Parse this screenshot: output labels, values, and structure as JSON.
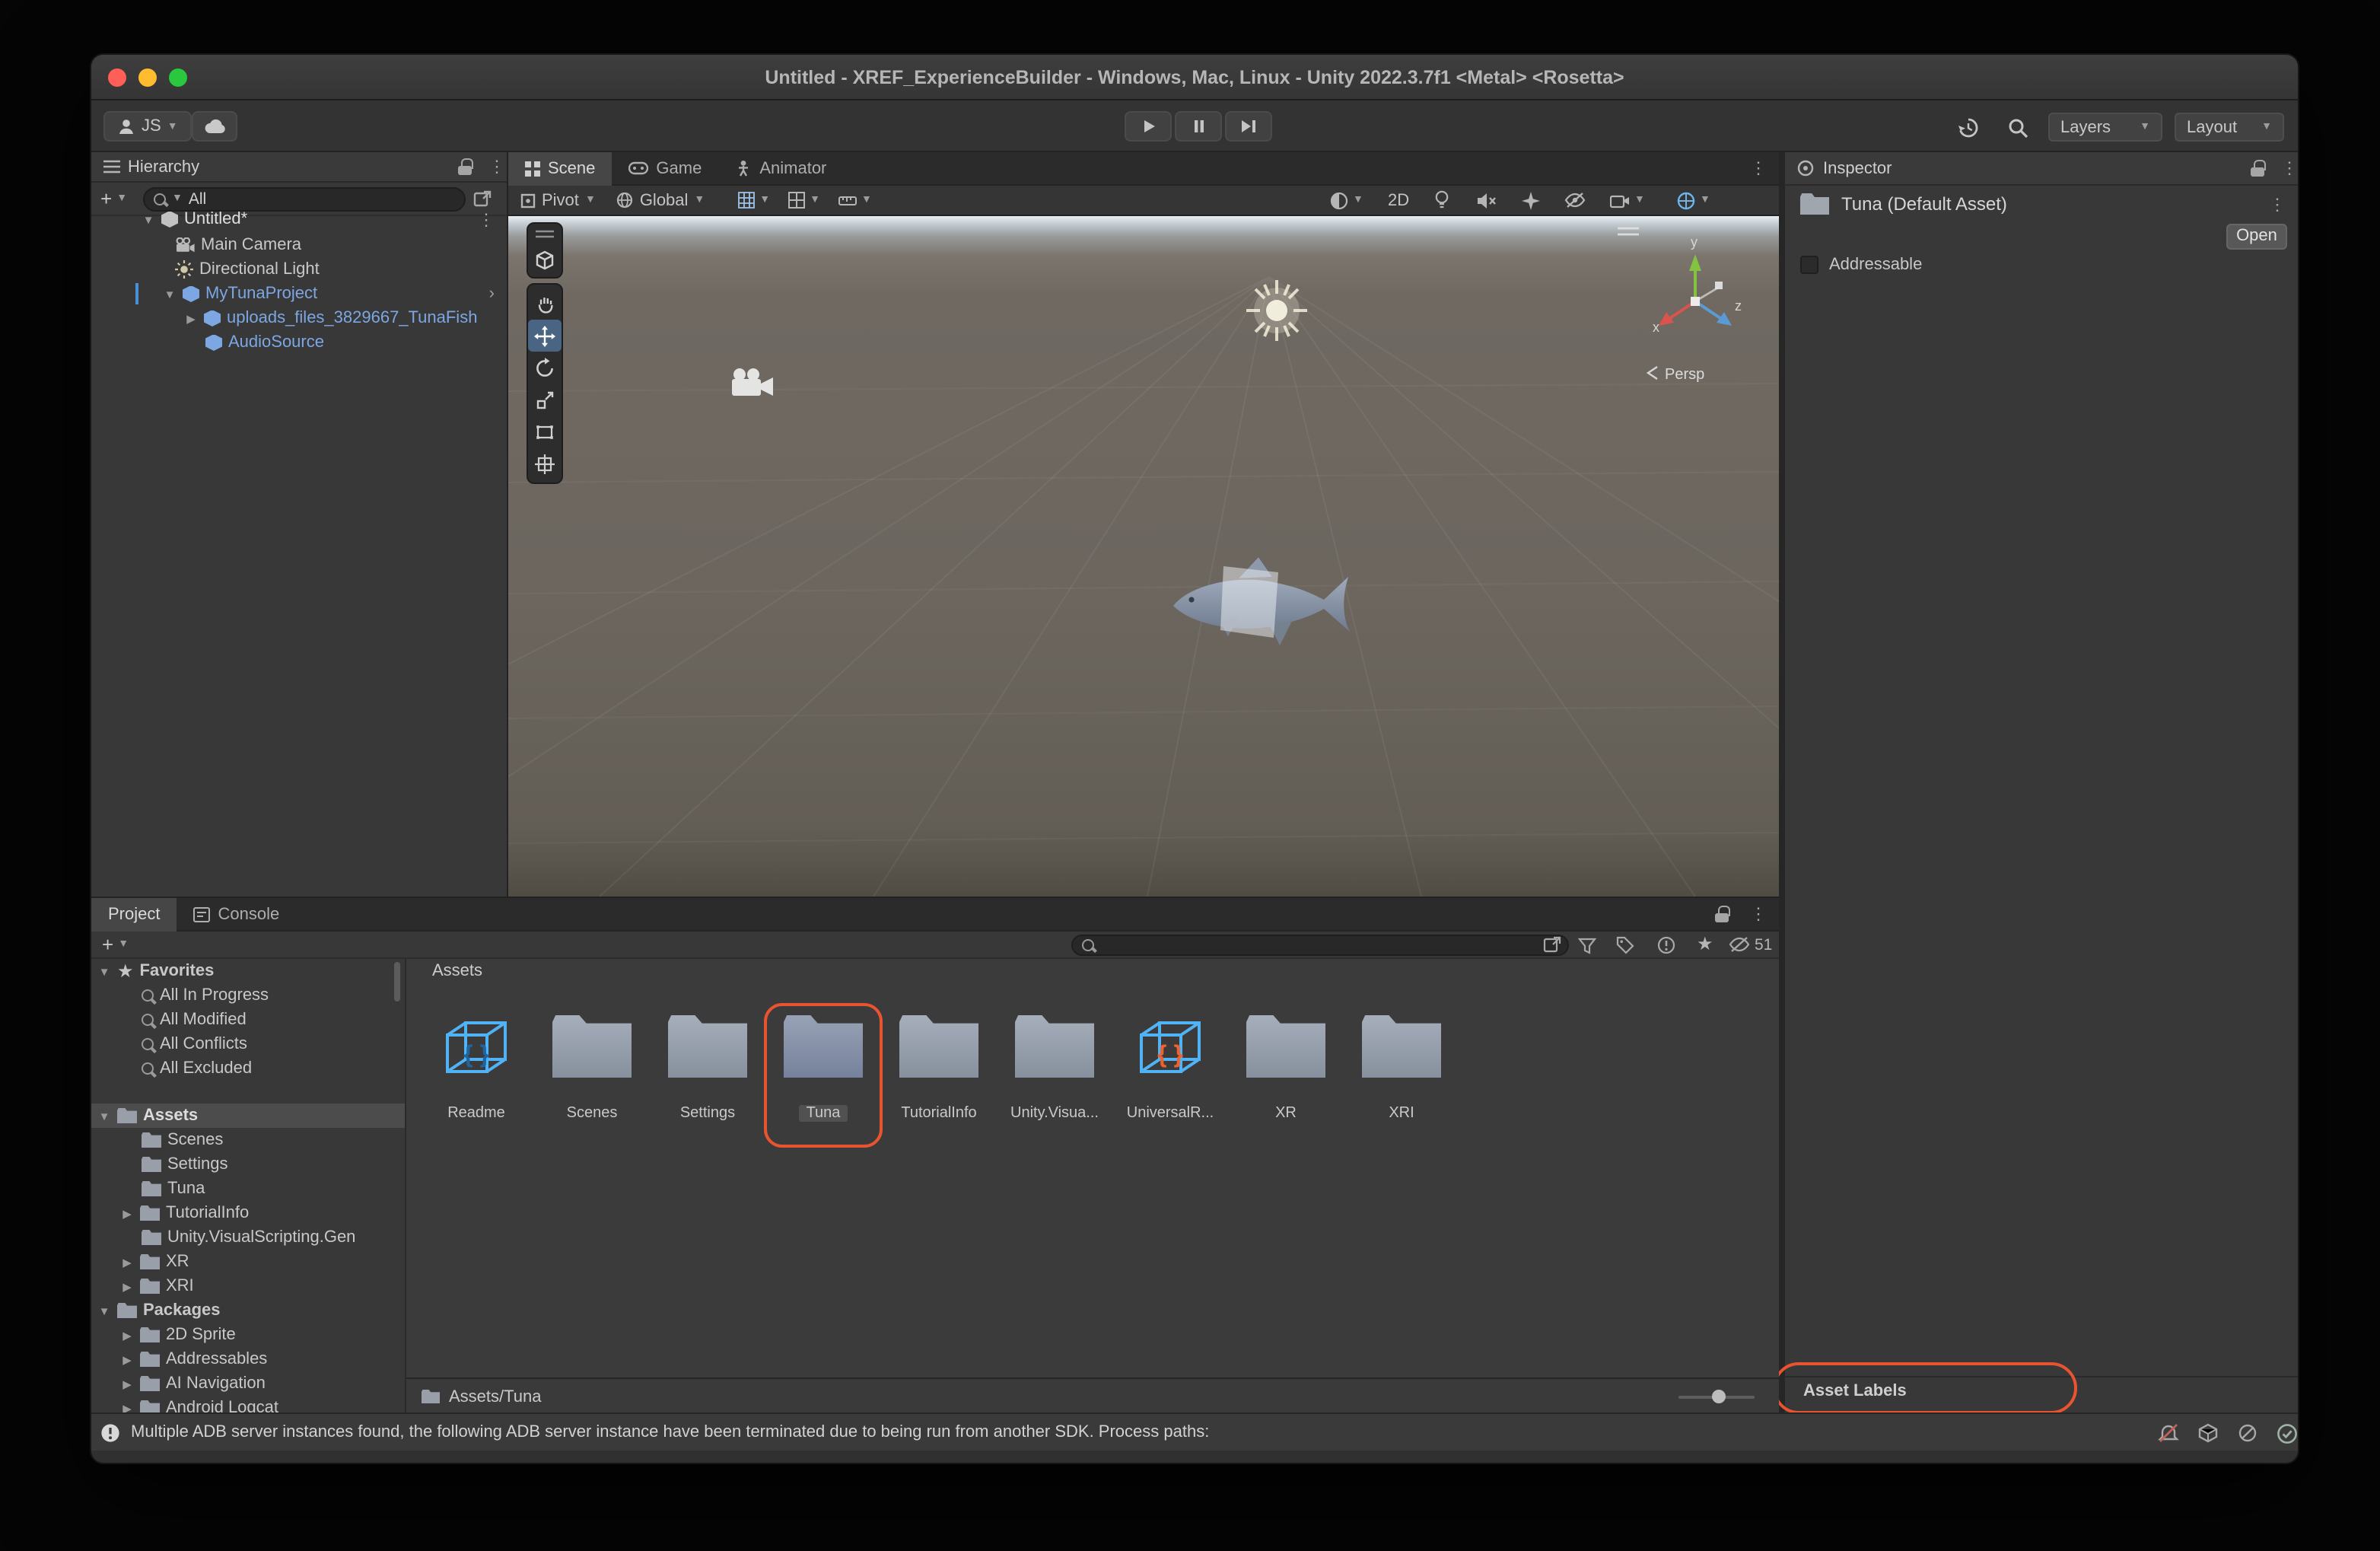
{
  "window": {
    "title": "Untitled - XREF_ExperienceBuilder - Windows, Mac, Linux - Unity 2022.3.7f1 <Metal> <Rosetta>"
  },
  "toolbar": {
    "account": "JS",
    "layers": "Layers",
    "layout": "Layout"
  },
  "hierarchy": {
    "title": "Hierarchy",
    "search": "All",
    "items": [
      {
        "label": "Untitled*"
      },
      {
        "label": "Main Camera"
      },
      {
        "label": "Directional Light"
      },
      {
        "label": "MyTunaProject"
      },
      {
        "label": "uploads_files_3829667_TunaFish"
      },
      {
        "label": "AudioSource"
      }
    ]
  },
  "scene": {
    "tabs": [
      "Scene",
      "Game",
      "Animator"
    ],
    "pivot": "Pivot",
    "global": "Global",
    "two_d": "2D",
    "persp": "Persp",
    "axis": {
      "x": "x",
      "y": "y",
      "z": "z"
    }
  },
  "inspector": {
    "title": "Inspector",
    "asset": "Tuna (Default Asset)",
    "open": "Open",
    "addressable": "Addressable",
    "asset_labels": "Asset Labels"
  },
  "project": {
    "tab_project": "Project",
    "tab_console": "Console",
    "hidden_count": "51",
    "favorites": {
      "label": "Favorites",
      "items": [
        "All In Progress",
        "All Modified",
        "All Conflicts",
        "All Excluded"
      ]
    },
    "assets": {
      "label": "Assets",
      "items": [
        "Scenes",
        "Settings",
        "Tuna",
        "TutorialInfo",
        "Unity.VisualScripting.Gen",
        "XR",
        "XRI"
      ]
    },
    "packages": {
      "label": "Packages",
      "items": [
        "2D Sprite",
        "Addressables",
        "AI Navigation",
        "Android Logcat"
      ]
    },
    "grid": {
      "header": "Assets",
      "items": [
        {
          "label": "Readme",
          "kind": "script-asset"
        },
        {
          "label": "Scenes",
          "kind": "folder"
        },
        {
          "label": "Settings",
          "kind": "folder"
        },
        {
          "label": "Tuna",
          "kind": "folder",
          "selected": true
        },
        {
          "label": "TutorialInfo",
          "kind": "folder"
        },
        {
          "label": "Unity.Visua...",
          "kind": "folder"
        },
        {
          "label": "UniversalR...",
          "kind": "script-asset"
        },
        {
          "label": "XR",
          "kind": "folder"
        },
        {
          "label": "XRI",
          "kind": "folder"
        }
      ]
    },
    "breadcrumb": "Assets/Tuna"
  },
  "status": {
    "message": "Multiple ADB server instances found, the following ADB server instance have been terminated due to being run from another SDK. Process paths:"
  },
  "colors": {
    "annotation": "#E85430",
    "prefab_blue": "#7CA7E2",
    "selection_gray": "#4C4C4C"
  }
}
